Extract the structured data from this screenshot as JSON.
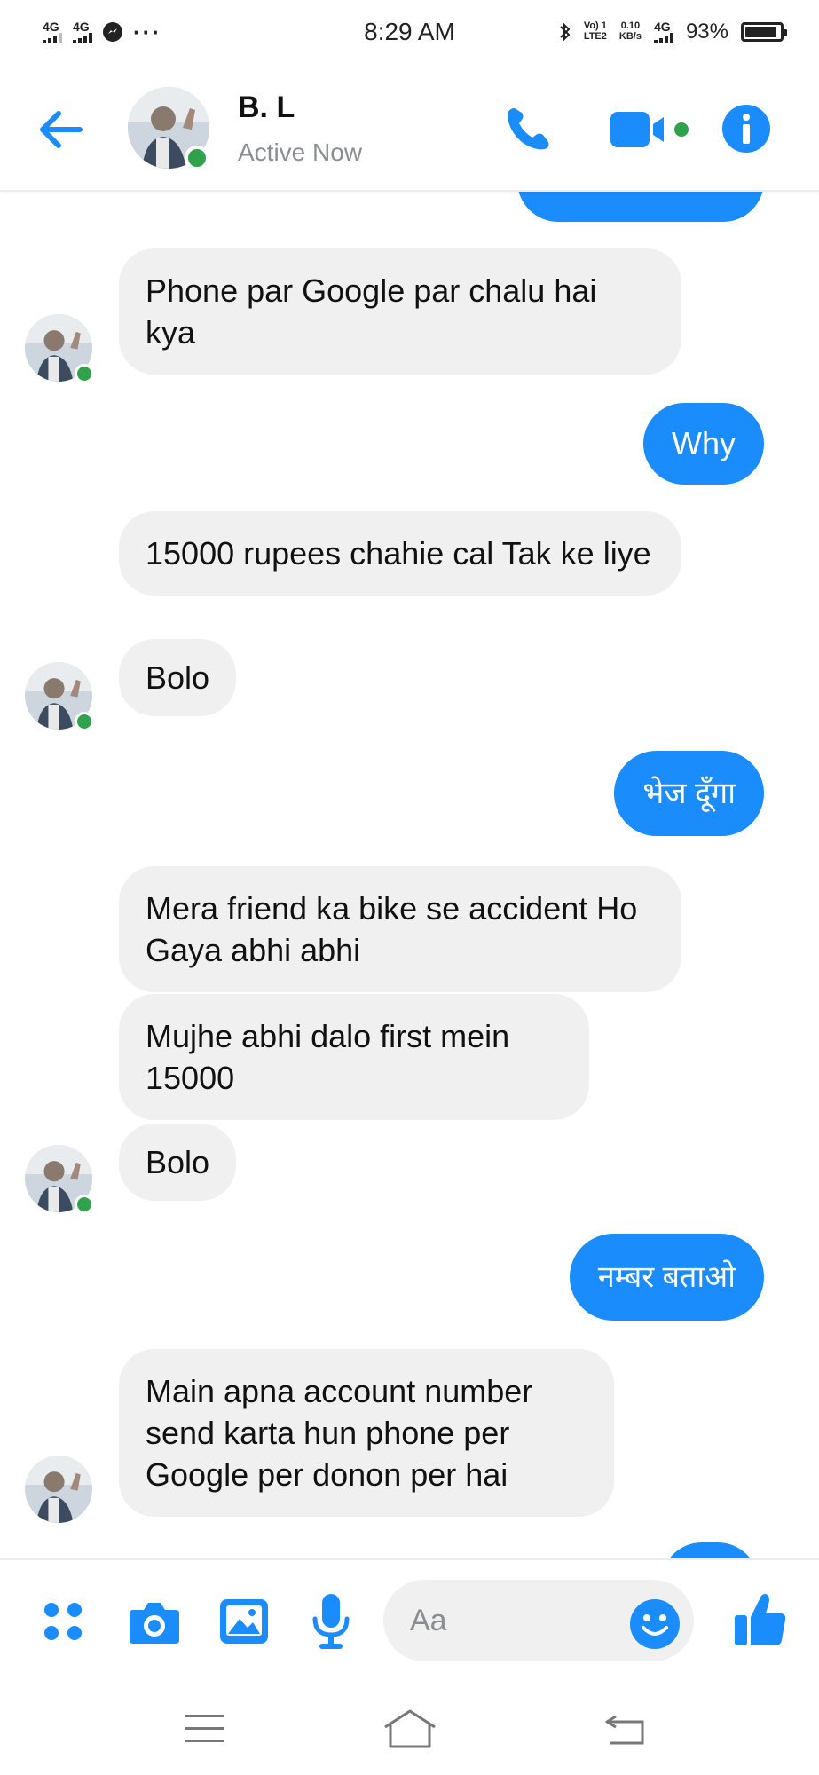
{
  "status_bar": {
    "network_1": "4G",
    "network_2": "4G",
    "time": "8:29 AM",
    "volte_1": "Vo) 1",
    "volte_2": "LTE2",
    "speed_value": "0.10",
    "speed_unit": "KB/s",
    "network_3": "4G",
    "battery_percent": "93%",
    "battery_level": 0.93
  },
  "header": {
    "contact_name": "B. L",
    "presence": "Active Now"
  },
  "messages": [
    {
      "from": "them",
      "text": "Phone par Google par chalu hai kya"
    },
    {
      "from": "me",
      "text": "Why"
    },
    {
      "from": "them",
      "text": "15000 rupees chahie cal Tak ke liye"
    },
    {
      "from": "them",
      "text": "Bolo"
    },
    {
      "from": "me",
      "text": "भेज दूँगा"
    },
    {
      "from": "them",
      "text": "Mera friend ka bike se accident Ho Gaya abhi abhi"
    },
    {
      "from": "them",
      "text": "Mujhe abhi dalo first mein 15000"
    },
    {
      "from": "them",
      "text": "Bolo"
    },
    {
      "from": "me",
      "text": "नम्बर बताओ"
    },
    {
      "from": "them",
      "text": "Main apna account number send karta hun phone per Google per donon per hai"
    }
  ],
  "composer": {
    "placeholder": "Aa"
  },
  "colors": {
    "accent": "#1a8cfb",
    "incoming_bubble": "#f0f0f0",
    "online": "#31a24c"
  },
  "icons": [
    "back-arrow-icon",
    "phone-icon",
    "video-camera-icon",
    "info-icon",
    "menu-grid-icon",
    "camera-icon",
    "image-icon",
    "microphone-icon",
    "emoji-icon",
    "thumbs-up-icon",
    "menu-lines-icon",
    "home-icon",
    "back-nav-icon"
  ]
}
